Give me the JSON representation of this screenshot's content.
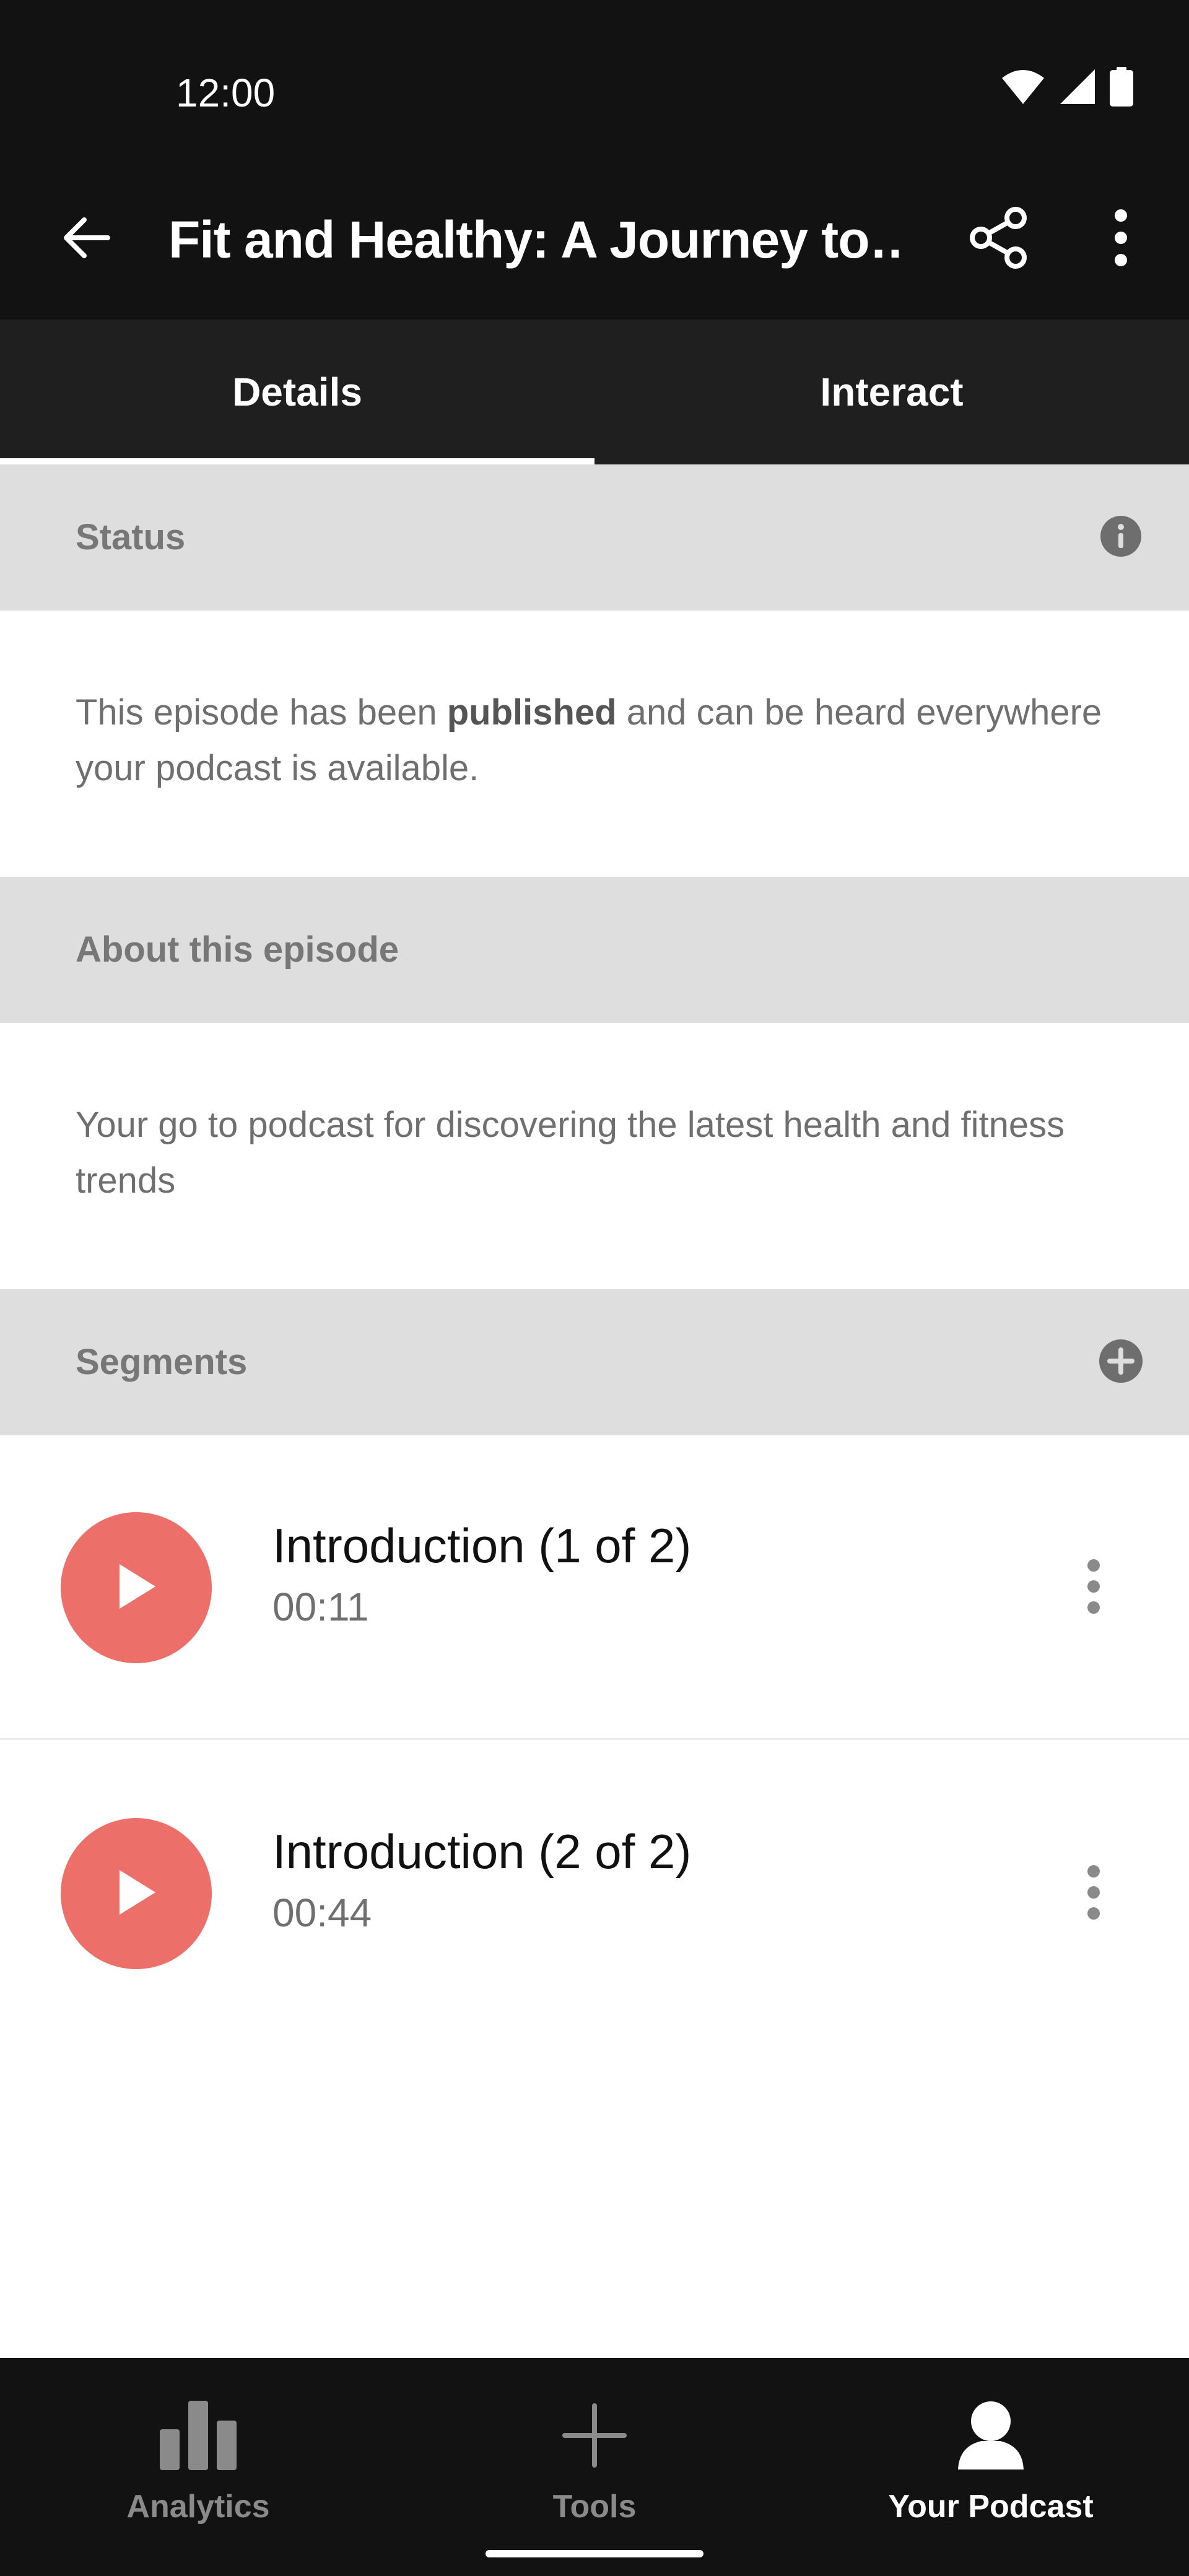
{
  "status_bar": {
    "time": "12:00",
    "icons": [
      "wifi-icon",
      "cell-signal-icon",
      "battery-icon"
    ]
  },
  "app_bar": {
    "title": "Fit and Healthy: A Journey to…",
    "back_icon": "arrow-back-icon",
    "share_icon": "share-icon",
    "more_icon": "more-vert-icon"
  },
  "tabs": [
    {
      "label": "Details",
      "active": true
    },
    {
      "label": "Interact",
      "active": false
    }
  ],
  "status_section": {
    "header": "Status",
    "info_icon": "info-icon",
    "text_before": "This episode has been ",
    "text_bold": "published",
    "text_after": " and can be heard everywhere your podcast is available."
  },
  "about_section": {
    "header": "About this episode",
    "text": "Your go to podcast for discovering the latest health and fitness trends"
  },
  "segments_section": {
    "header": "Segments",
    "add_icon": "add-circle-icon",
    "items": [
      {
        "title": "Introduction (1 of 2)",
        "duration": "00:11"
      },
      {
        "title": "Introduction (2 of 2)",
        "duration": "00:44"
      }
    ]
  },
  "bottom_nav": [
    {
      "label": "Analytics",
      "icon": "bar-chart-icon",
      "active": false
    },
    {
      "label": "Tools",
      "icon": "plus-icon",
      "active": false
    },
    {
      "label": "Your Podcast",
      "icon": "person-icon",
      "active": true
    }
  ],
  "colors": {
    "dark_bg": "#121212",
    "tab_bg": "#1f1f1f",
    "section_header_bg": "#dedede",
    "play_button": "#ec6f6a"
  }
}
